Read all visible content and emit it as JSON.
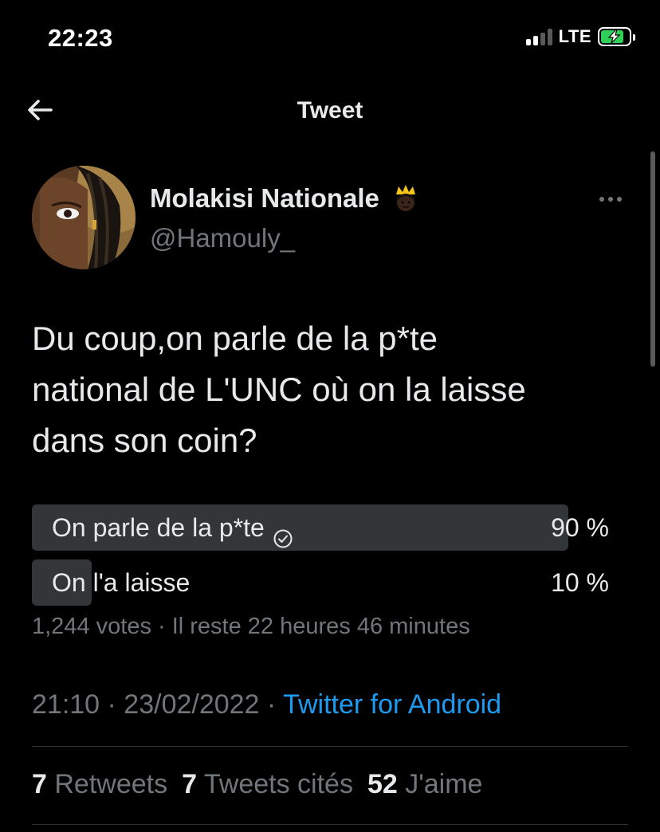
{
  "status_bar": {
    "time": "22:23",
    "network": "LTE",
    "signal_bars_active": 2,
    "signal_bars_total": 4,
    "battery_fill_fraction": 0.85,
    "battery_color": "#30d158",
    "charging": true
  },
  "nav": {
    "title": "Tweet",
    "back_icon": "arrow-left-icon"
  },
  "author": {
    "name": "Molakisi Nationale",
    "handle": "@Hamouly_",
    "emoji_icon": "crown-princess-icon",
    "more_icon": "more-horizontal-icon"
  },
  "tweet": {
    "text": "Du coup,on parle de la p*te\nnational de L'UNC où on la laisse\ndans son coin?"
  },
  "poll": {
    "options": [
      {
        "label": "On parle de la p*te",
        "percent_label": "90 %",
        "percent": 90,
        "selected": true
      },
      {
        "label": "On l'a laisse",
        "percent_label": "10 %",
        "percent": 10,
        "selected": false
      }
    ],
    "meta": "1,244 votes · Il reste 22 heures 46 minutes",
    "bar_color": "#333639",
    "winner_bar_color": "#333639"
  },
  "timestamp": {
    "time_date": "21:10 · 23/02/2022 · ",
    "source": "Twitter for Android"
  },
  "stats": {
    "retweets_count": "7",
    "retweets_label": "Retweets",
    "quotes_count": "7",
    "quotes_label": "Tweets cités",
    "likes_count": "52",
    "likes_label": "J'aime"
  },
  "colors": {
    "accent": "#1d9bf0",
    "secondary_text": "#71767b",
    "primary_text": "#e7e9ea"
  }
}
